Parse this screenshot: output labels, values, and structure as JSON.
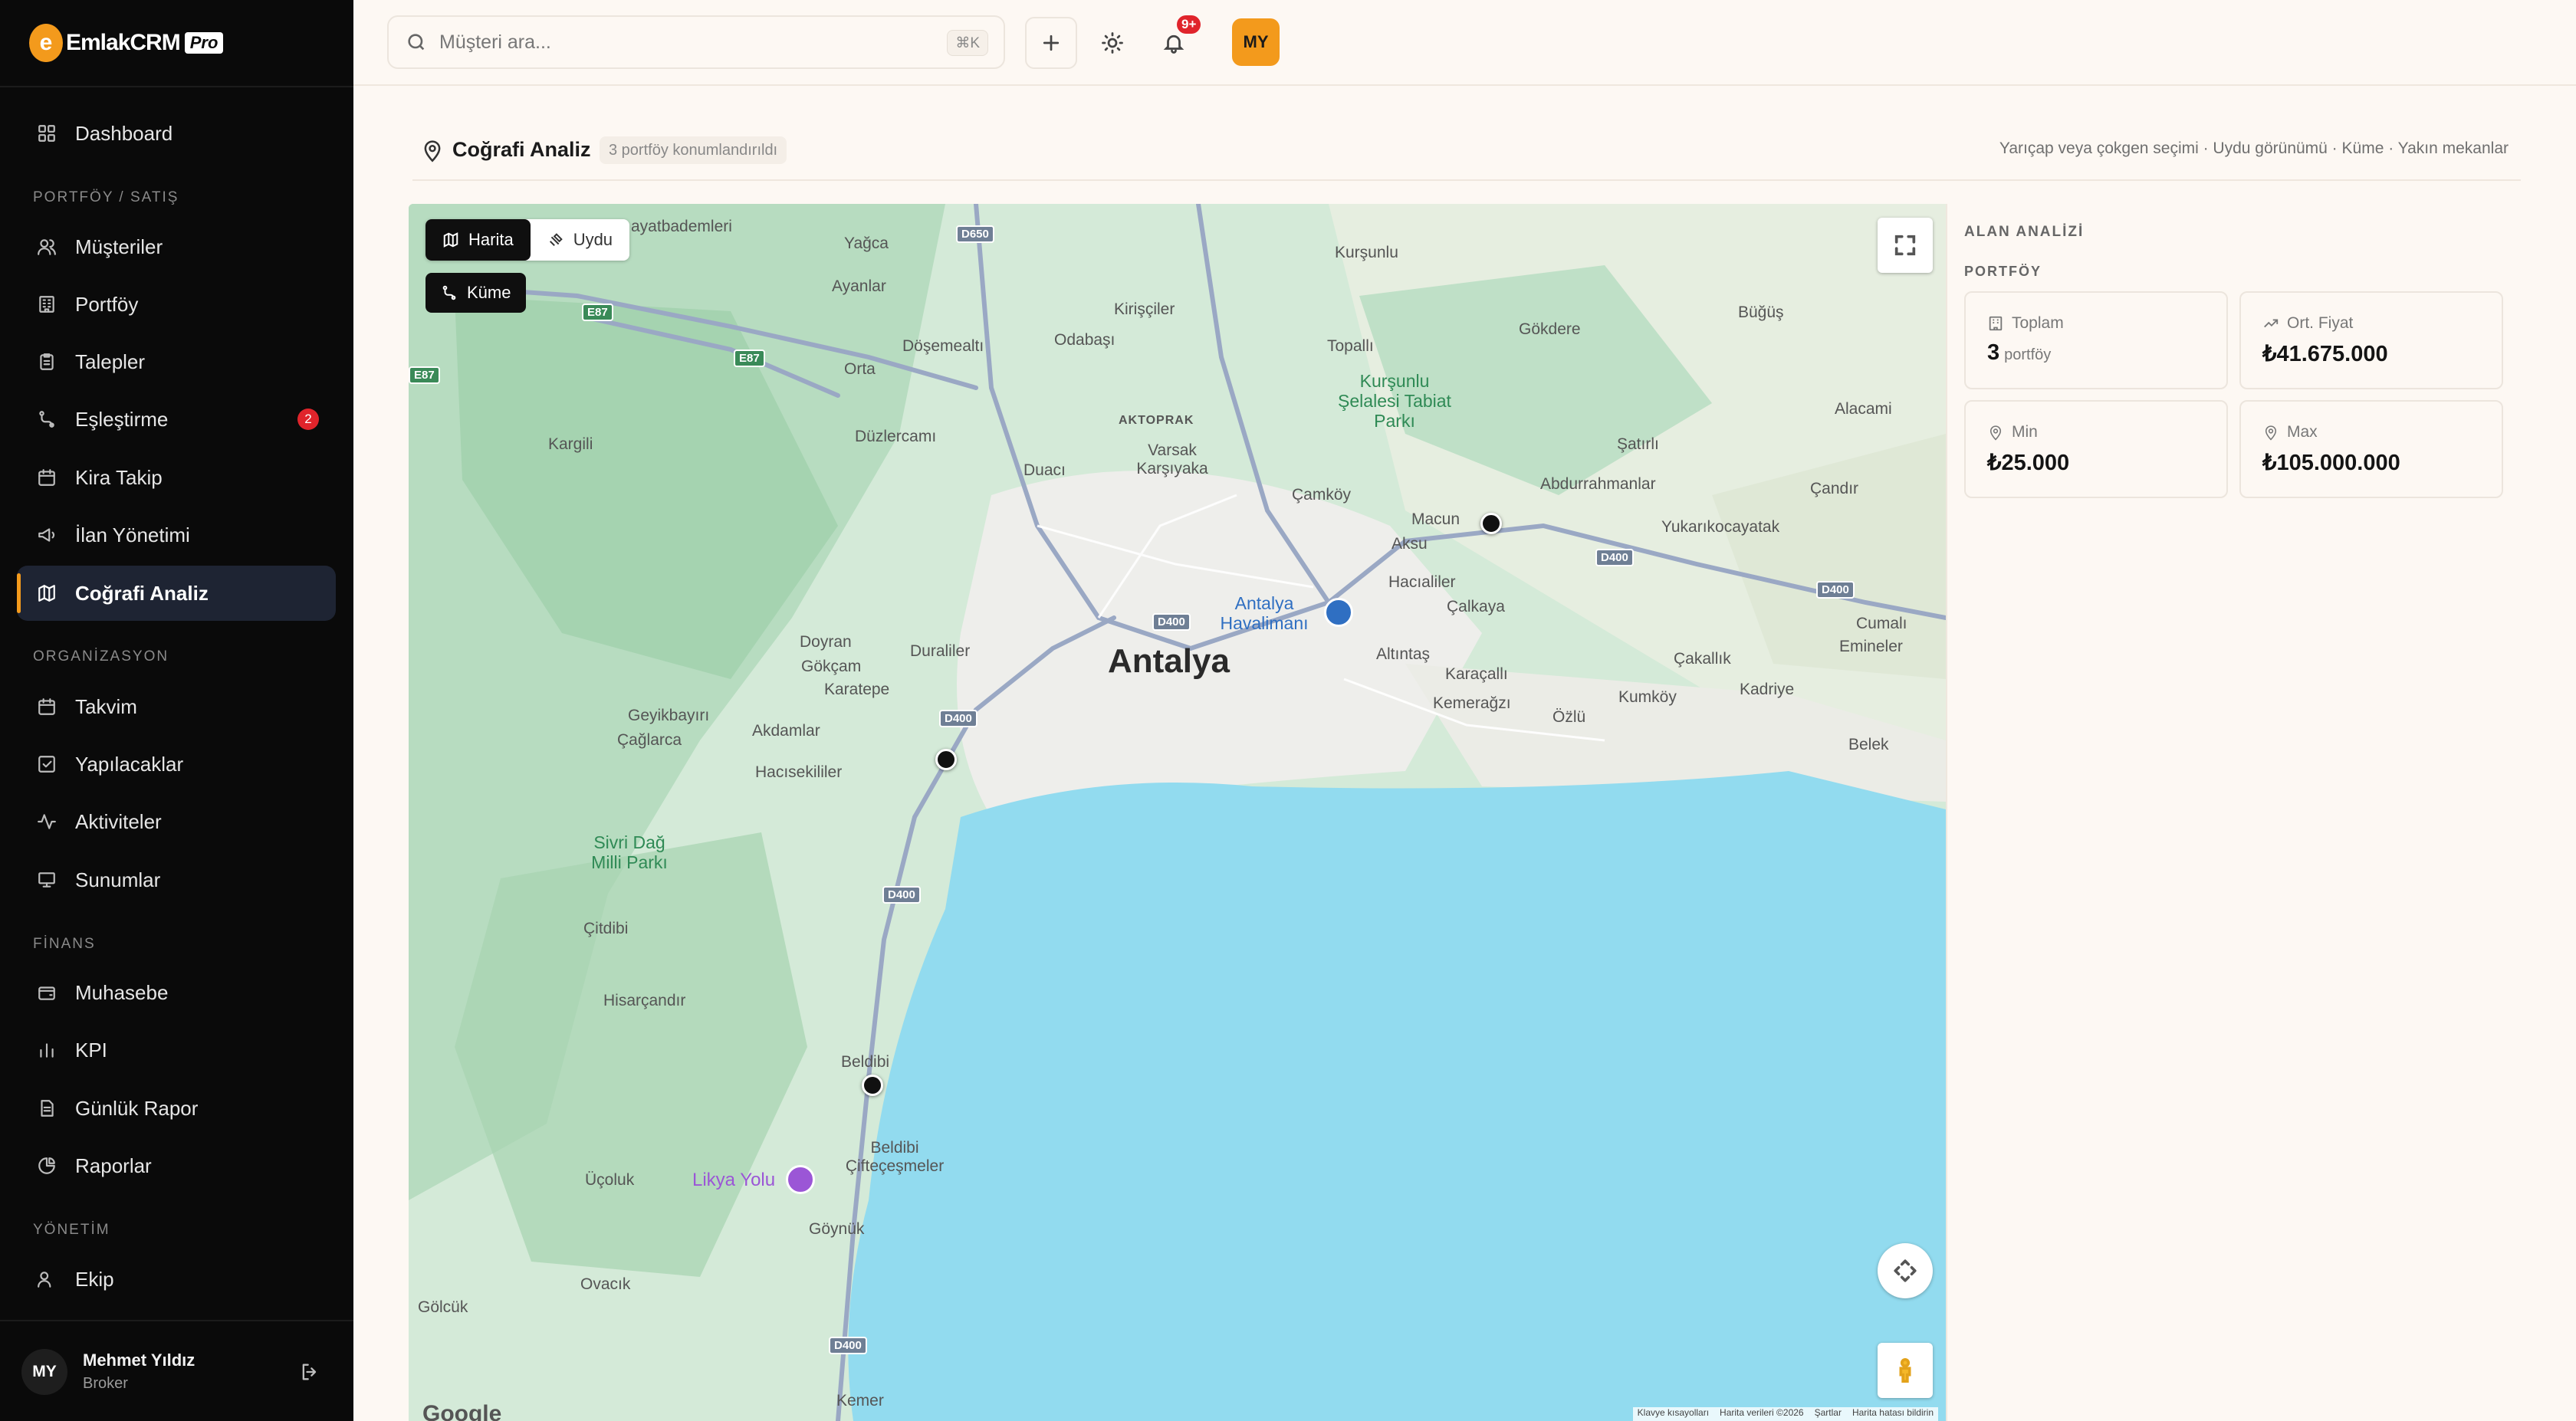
{
  "brand": {
    "name": "EmlakCRM",
    "badge": "Pro",
    "accent": "#f39a1c"
  },
  "sidebar": {
    "dashboard": "Dashboard",
    "sections": {
      "portfolio": "PORTFÖY / SATIŞ",
      "organization": "ORGANİZASYON",
      "finance": "FİNANS",
      "management": "YÖNETİM"
    },
    "items": [
      {
        "label": "Müşteriler",
        "icon": "users-icon"
      },
      {
        "label": "Portföy",
        "icon": "building-icon"
      },
      {
        "label": "Talepler",
        "icon": "clipboard-icon"
      },
      {
        "label": "Eşleştirme",
        "icon": "route-icon",
        "badge": "2"
      },
      {
        "label": "Kira Takip",
        "icon": "calendar-icon"
      },
      {
        "label": "İlan Yönetimi",
        "icon": "megaphone-icon"
      },
      {
        "label": "Coğrafi Analiz",
        "icon": "map-icon",
        "active": true
      },
      {
        "label": "Takvim",
        "icon": "calendar-icon"
      },
      {
        "label": "Yapılacaklar",
        "icon": "checkbox-icon"
      },
      {
        "label": "Aktiviteler",
        "icon": "activity-icon"
      },
      {
        "label": "Sunumlar",
        "icon": "presentation-icon"
      },
      {
        "label": "Muhasebe",
        "icon": "wallet-icon"
      },
      {
        "label": "KPI",
        "icon": "bar-chart-icon"
      },
      {
        "label": "Günlük Rapor",
        "icon": "report-icon"
      },
      {
        "label": "Raporlar",
        "icon": "pie-chart-icon"
      },
      {
        "label": "Ekip",
        "icon": "team-icon"
      }
    ],
    "user": {
      "initials": "MY",
      "name": "Mehmet Yıldız",
      "role": "Broker"
    }
  },
  "topbar": {
    "search_placeholder": "Müşteri ara...",
    "shortcut": "⌘K",
    "notif_badge": "9+",
    "avatar": "MY"
  },
  "page": {
    "title": "Coğrafi Analiz",
    "subtitle": "3 portföy konumlandırıldı",
    "hint": "Yarıçap veya çokgen seçimi · Uydu görünümü · Küme · Yakın mekanlar"
  },
  "map": {
    "mode_map": "Harita",
    "mode_satellite": "Uydu",
    "cluster": "Küme",
    "provider": "Google",
    "attribution": [
      "Klavye kısayolları",
      "Harita verileri ©2026",
      "Şartlar",
      "Harita hatası bildirin"
    ],
    "labels": {
      "city": "Antalya",
      "places": [
        "Yağca",
        "Kurşunlu",
        "Ayanlar",
        "Kirişçiler",
        "Döşemealtı",
        "Odabaşı",
        "Topallı",
        "Gökdere",
        "Büğüş",
        "Orta",
        "Alacami",
        "Kargili",
        "Düzlercamı",
        "Varsak Karşıyaka",
        "Duacı",
        "Şatırlı",
        "Abdurrahmanlar",
        "Çandır",
        "Çamköy",
        "Macun",
        "Yukarıkocayatak",
        "Aksu",
        "Hacıaliler",
        "Çalkaya",
        "Cumalı",
        "Emineler",
        "Doyran",
        "Duraliler",
        "Gökçam",
        "Karatepe",
        "Altıntaş",
        "Karaçallı",
        "Kemerağzı",
        "Öz̈lü",
        "Kumköy",
        "Kadriye",
        "Çakallık",
        "Geyikbayırı",
        "Çağlarca",
        "Akdamlar",
        "Hacısekililer",
        "Belek",
        "Çitdibi",
        "Hisarçandır",
        "Beldibi",
        "Beldibi Çifteçeşmeler",
        "Üçoluk",
        "Göynük",
        "Ovacık",
        "Gölcük",
        "Kemer",
        "ayatbademleri",
        "AKTOPRAK"
      ],
      "park": "Kurşunlu Şelalesi Tabiat Parkı",
      "park2": "Sivri Dağ Milli Parkı",
      "airport": "Antalya Havalimanı",
      "poi": "Likya Yolu",
      "roads": [
        "D650",
        "E87",
        "E87",
        "E87",
        "D400",
        "D400",
        "D400",
        "D400",
        "D400",
        "D400"
      ]
    }
  },
  "panel": {
    "title": "ALAN ANALİZİ",
    "subtitle": "PORTFÖY",
    "stats": {
      "total_label": "Toplam",
      "total_value": "3",
      "total_unit": "portföy",
      "avg_label": "Ort. Fiyat",
      "avg_value": "₺41.675.000",
      "min_label": "Min",
      "min_value": "₺25.000",
      "max_label": "Max",
      "max_value": "₺105.000.000"
    }
  }
}
